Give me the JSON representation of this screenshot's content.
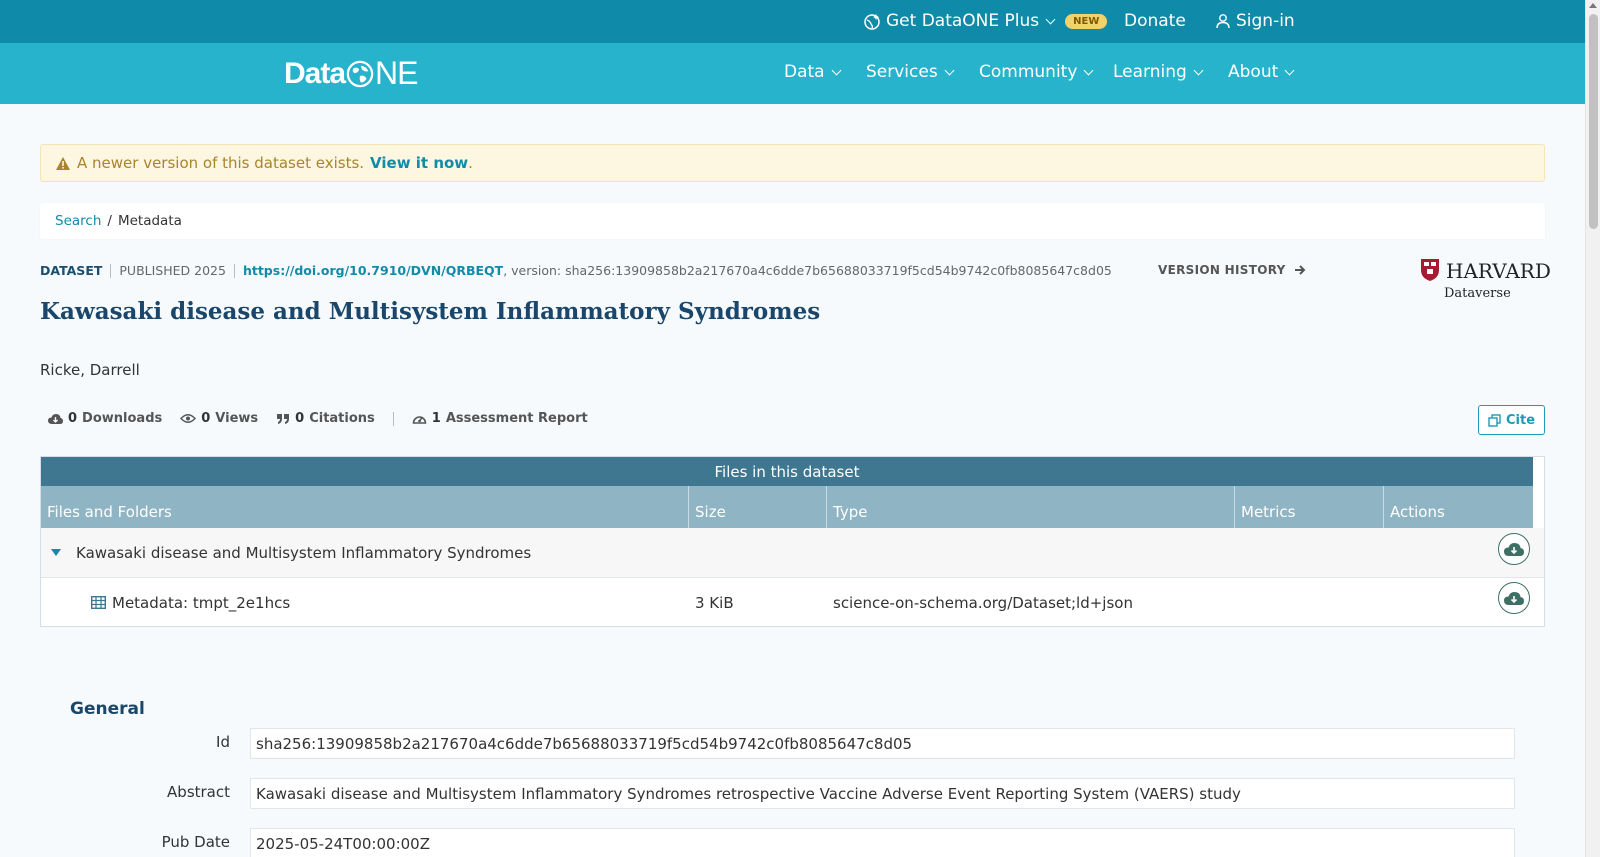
{
  "topbar": {
    "plus_label": "Get DataONE Plus",
    "new_badge": "NEW",
    "donate_label": "Donate",
    "signin_label": "Sign-in"
  },
  "brand": {
    "logo_text_1": "Data",
    "logo_text_2": "NE"
  },
  "nav": [
    {
      "label": "Data"
    },
    {
      "label": "Services"
    },
    {
      "label": "Community"
    },
    {
      "label": "Learning"
    },
    {
      "label": "About"
    }
  ],
  "alert": {
    "text": "A newer version of this dataset exists.",
    "link": "View it now",
    "trailing": "."
  },
  "breadcrumb": {
    "search": "Search",
    "separator": "/",
    "current": "Metadata"
  },
  "dataset": {
    "type_label": "DATASET",
    "published": "PUBLISHED 2025",
    "doi": "https://doi.org/10.7910/DVN/QRBEQT",
    "version": ", version: sha256:13909858b2a217670a4c6dde7b65688033719f5cd54b9742c0fb8085647c8d05",
    "version_history": "VERSION HISTORY",
    "title": "Kawasaki disease and Multisystem Inflammatory Syndromes",
    "author": "Ricke, Darrell",
    "repository_name": "HARVARD",
    "repository_sub": "Dataverse"
  },
  "metrics": {
    "downloads_count": "0",
    "downloads_label": "Downloads",
    "views_count": "0",
    "views_label": "Views",
    "citations_count": "0",
    "citations_label": "Citations",
    "assessment_count": "1",
    "assessment_label": "Assessment Report",
    "cite_label": "Cite"
  },
  "files": {
    "header": "Files in this dataset",
    "columns": [
      "Files and Folders",
      "Size",
      "Type",
      "Metrics",
      "Actions"
    ],
    "folder": {
      "name": "Kawasaki disease and Multisystem Inflammatory Syndromes"
    },
    "rows": [
      {
        "name": "Metadata: tmpt_2e1hcs",
        "size": "3 KiB",
        "type": "science-on-schema.org/Dataset;ld+json"
      }
    ]
  },
  "general": {
    "title": "General",
    "fields": [
      {
        "label": "Id",
        "value": "sha256:13909858b2a217670a4c6dde7b65688033719f5cd54b9742c0fb8085647c8d05"
      },
      {
        "label": "Abstract",
        "value": "Kawasaki disease and Multisystem Inflammatory Syndromes retrospective Vaccine Adverse Event Reporting System (VAERS) study"
      },
      {
        "label": "Pub Date",
        "value": "2025-05-24T00:00:00Z"
      }
    ]
  },
  "colors": {
    "topbar": "#0f8aa8",
    "navbar": "#27b3cc",
    "accent": "#128ba9",
    "title": "#19466a",
    "files_header": "#3f7690",
    "files_columns": "#8fb4c4"
  }
}
